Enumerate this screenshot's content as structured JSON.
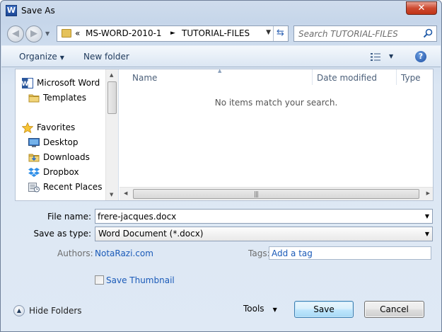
{
  "window": {
    "title": "Save As",
    "app_icon_letter": "W",
    "close_glyph": "✕"
  },
  "navigation": {
    "back_glyph": "◀",
    "forward_glyph": "▶",
    "breadcrumbs": [
      "«",
      "MS-WORD-2010-1",
      "TUTORIAL-FILES"
    ],
    "separator_glyph": "►"
  },
  "search": {
    "placeholder": "Search TUTORIAL-FILES"
  },
  "toolbar": {
    "organize_label": "Organize",
    "new_folder_label": "New folder",
    "help_label": "?"
  },
  "nav_pane": {
    "items": [
      {
        "label": "Microsoft Word",
        "icon": "word-doc-icon"
      },
      {
        "label": "Templates",
        "icon": "folder-icon"
      },
      {
        "label": "Favorites",
        "icon": "star-icon"
      },
      {
        "label": "Desktop",
        "icon": "desktop-icon"
      },
      {
        "label": "Downloads",
        "icon": "downloads-icon"
      },
      {
        "label": "Dropbox",
        "icon": "dropbox-icon"
      },
      {
        "label": "Recent Places",
        "icon": "recent-places-icon"
      }
    ]
  },
  "file_list": {
    "columns": [
      "Name",
      "Date modified",
      "Type"
    ],
    "empty_message": "No items match your search."
  },
  "form": {
    "file_name_label": "File name:",
    "file_name_value": "frere-jacques.docx",
    "save_as_type_label": "Save as type:",
    "save_as_type_value": "Word Document (*.docx)",
    "authors_label": "Authors:",
    "authors_value": "NotaRazi.com",
    "tags_label": "Tags:",
    "tags_placeholder": "Add a tag",
    "save_thumbnail_label": "Save Thumbnail",
    "save_thumbnail_checked": false
  },
  "footer": {
    "hide_folders_label": "Hide Folders",
    "tools_label": "Tools",
    "save_label": "Save",
    "cancel_label": "Cancel"
  },
  "colors": {
    "link": "#1a5ab8",
    "folder": "#e5c25a",
    "accent_button": "#a7d9f5"
  }
}
